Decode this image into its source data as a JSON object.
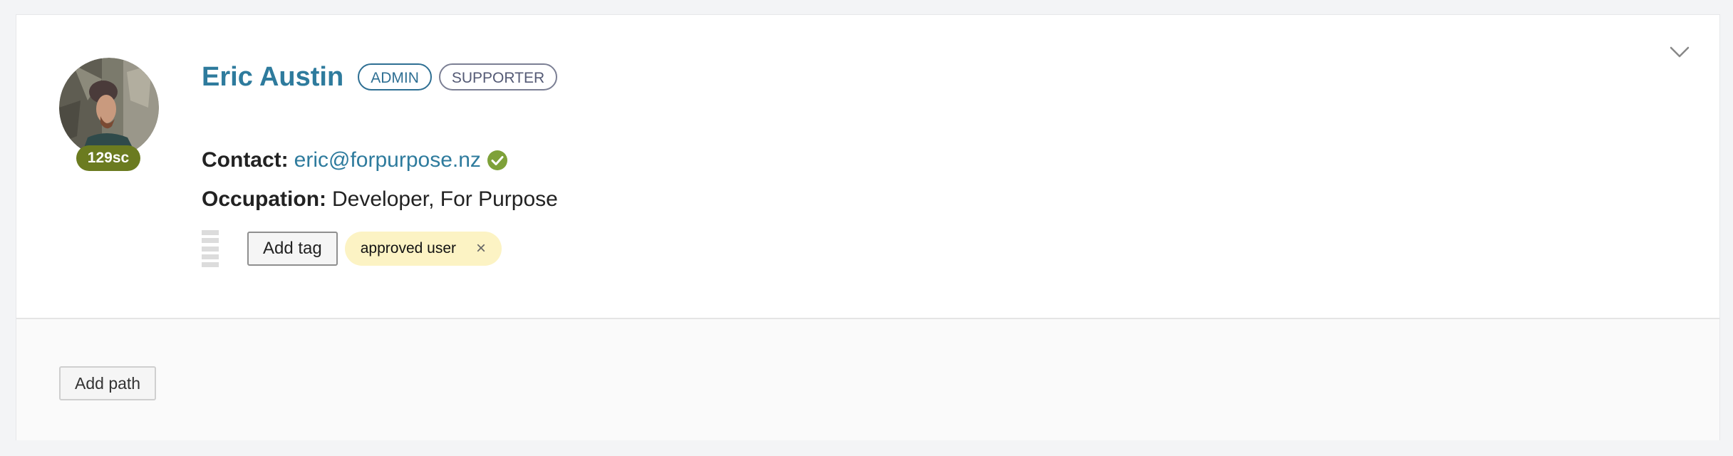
{
  "profile": {
    "name": "Eric Austin",
    "roles": [
      "ADMIN",
      "SUPPORTER"
    ],
    "score": "129sc",
    "contact_label": "Contact:",
    "email": "eric@forpurpose.nz",
    "email_verified": true,
    "occupation_label": "Occupation:",
    "occupation": "Developer, For Purpose"
  },
  "tags": {
    "add_label": "Add tag",
    "items": [
      {
        "label": "approved user",
        "remove_symbol": "×"
      }
    ]
  },
  "paths": {
    "add_label": "Add path"
  },
  "icons": {
    "collapse": "chevron-down-icon",
    "verified": "check-circle-icon",
    "drag": "drag-handle-icon",
    "remove": "close-icon"
  },
  "colors": {
    "accent": "#2e7b9d",
    "admin_pill": "#2e6f93",
    "supporter_pill": "#7b7f94",
    "score_badge": "#6b7b20",
    "verified": "#7ea139",
    "tag_bg": "#fcf3c4"
  }
}
